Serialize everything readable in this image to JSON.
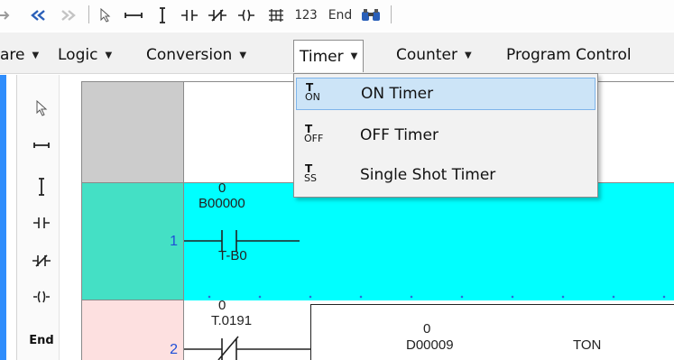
{
  "toolbar": {
    "items": [
      {
        "name": "redo-arrow-icon",
        "glyph": "➔"
      },
      {
        "name": "double-left-arrow-icon",
        "glyph": "«"
      },
      {
        "name": "double-right-arrow-icon",
        "glyph": "»"
      },
      {
        "name": "pointer-icon",
        "glyph": "⇖"
      },
      {
        "name": "horizontal-line-icon",
        "glyph": "⊷"
      },
      {
        "name": "vertical-line-icon",
        "glyph": "I"
      },
      {
        "name": "no-contact-icon",
        "glyph": "⊣⊢"
      },
      {
        "name": "nc-contact-icon",
        "glyph": "⊣/⊢"
      },
      {
        "name": "coil-icon",
        "glyph": "⊣⊢"
      },
      {
        "name": "function-icon",
        "glyph": "築"
      },
      {
        "name": "number-icon",
        "glyph": "123"
      },
      {
        "name": "end-icon",
        "glyph": "End"
      },
      {
        "name": "binoculars-icon",
        "glyph": "⊞"
      }
    ]
  },
  "menubar": {
    "items": [
      "are",
      "Logic",
      "Conversion",
      "Timer",
      "Counter",
      "Program Control"
    ],
    "open": "Timer"
  },
  "tools": [
    {
      "name": "pointer-tool-icon",
      "glyph": "⇖"
    },
    {
      "name": "horizontal-line-tool-icon",
      "glyph": "⊷"
    },
    {
      "name": "vertical-line-tool-icon",
      "glyph": "I"
    },
    {
      "name": "no-contact-tool-icon",
      "glyph": "⊣⊢"
    },
    {
      "name": "nc-contact-tool-icon",
      "glyph": "⊣/⊢"
    },
    {
      "name": "coil-tool-icon",
      "glyph": "{ }"
    },
    {
      "name": "end-tool-icon",
      "glyph": "End"
    }
  ],
  "ladder": {
    "rows": [
      {
        "number": "1",
        "count": "0",
        "device": "B00000",
        "tag": "T-B0"
      },
      {
        "number": "2",
        "count": "0",
        "device": "T.0191",
        "inner_count": "0",
        "inner_device": "D00009",
        "instruction": "TON"
      }
    ]
  },
  "dropdown": {
    "items": [
      {
        "label": "ON Timer",
        "icon_top": "T",
        "icon_sub": "ON",
        "highlighted": true
      },
      {
        "label": "OFF Timer",
        "icon_top": "T",
        "icon_sub": "OFF",
        "highlighted": false
      },
      {
        "label": "Single Shot Timer",
        "icon_top": "T",
        "icon_sub": "SS",
        "highlighted": false
      }
    ]
  },
  "colors": {
    "row1_bg": "#00ffff",
    "row1_num_bg": "#44e0c5",
    "row2_num_bg": "#fde0e0",
    "highlight": "#cce4f7",
    "row_number": "#1f4fd8"
  }
}
